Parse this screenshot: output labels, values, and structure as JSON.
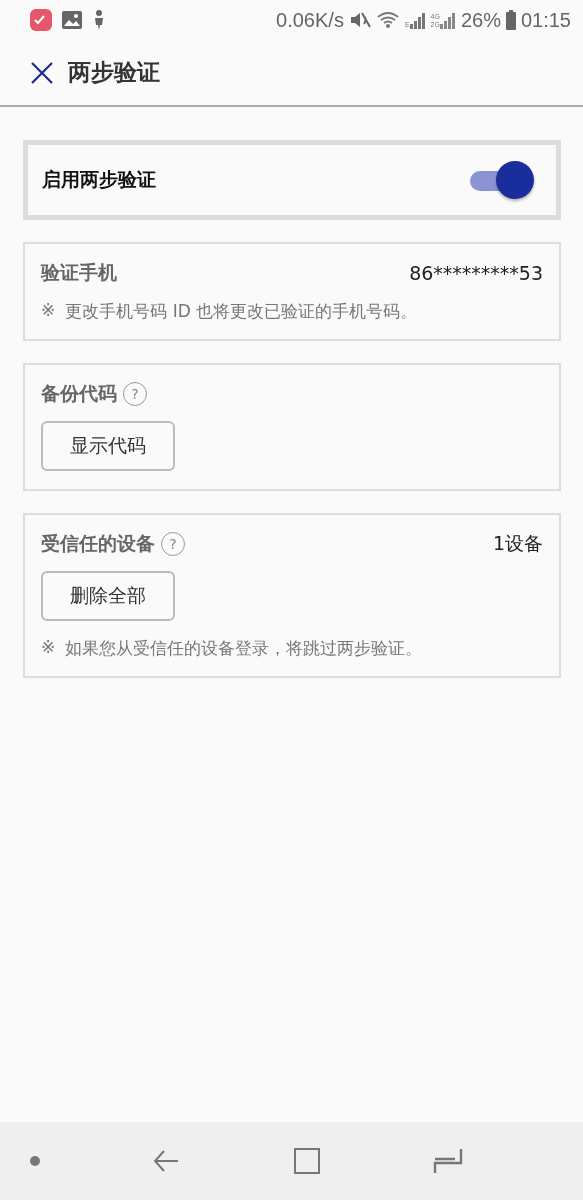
{
  "status_bar": {
    "net_speed": "0.06K/s",
    "sim1_label": "E",
    "sim2_labels": [
      "4G",
      "2G"
    ],
    "battery": "26%",
    "time": "01:15"
  },
  "header": {
    "title": "两步验证"
  },
  "enable": {
    "label": "启用两步验证",
    "on": true
  },
  "phone": {
    "title": "验证手机",
    "number": "86*********53",
    "note_mark": "※",
    "note": "更改手机号码 ID 也将更改已验证的手机号码。"
  },
  "backup": {
    "title": "备份代码",
    "help": "?",
    "button": "显示代码"
  },
  "devices": {
    "title": "受信任的设备",
    "help": "?",
    "count": "1设备",
    "button": "删除全部",
    "note_mark": "※",
    "note": "如果您从受信任的设备登录，将跳过两步验证。"
  }
}
